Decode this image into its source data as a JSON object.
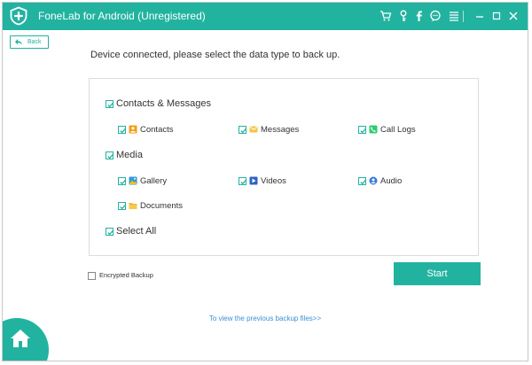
{
  "window": {
    "title": "FoneLab for Android (Unregistered)",
    "colors": {
      "accent": "#22b3a0",
      "link": "#3a8fd6",
      "checkbox_check": "#22b3a0"
    },
    "titlebar_icons": [
      "cart-icon",
      "key-icon",
      "facebook-icon",
      "chat-icon",
      "menu-icon",
      "minimize-icon",
      "maximize-icon",
      "close-icon"
    ]
  },
  "back_button": {
    "label": "Back"
  },
  "instruction": "Device connected, please select the data type to back up.",
  "groups": [
    {
      "label": "Contacts & Messages",
      "checked": true,
      "items": [
        {
          "label": "Contacts",
          "icon": "contacts-icon",
          "checked": true
        },
        {
          "label": "Messages",
          "icon": "messages-icon",
          "checked": true
        },
        {
          "label": "Call Logs",
          "icon": "call-logs-icon",
          "checked": true
        }
      ]
    },
    {
      "label": "Media",
      "checked": true,
      "items": [
        {
          "label": "Gallery",
          "icon": "gallery-icon",
          "checked": true
        },
        {
          "label": "Videos",
          "icon": "videos-icon",
          "checked": true
        },
        {
          "label": "Audio",
          "icon": "audio-icon",
          "checked": true
        },
        {
          "label": "Documents",
          "icon": "documents-icon",
          "checked": true
        }
      ]
    }
  ],
  "select_all": {
    "label": "Select All",
    "checked": true
  },
  "encrypted_backup": {
    "label": "Encrypted Backup",
    "checked": false
  },
  "start_button": {
    "label": "Start"
  },
  "previous_backup_link": "To view the previous backup files>>",
  "home_button": {
    "icon": "home-icon"
  }
}
